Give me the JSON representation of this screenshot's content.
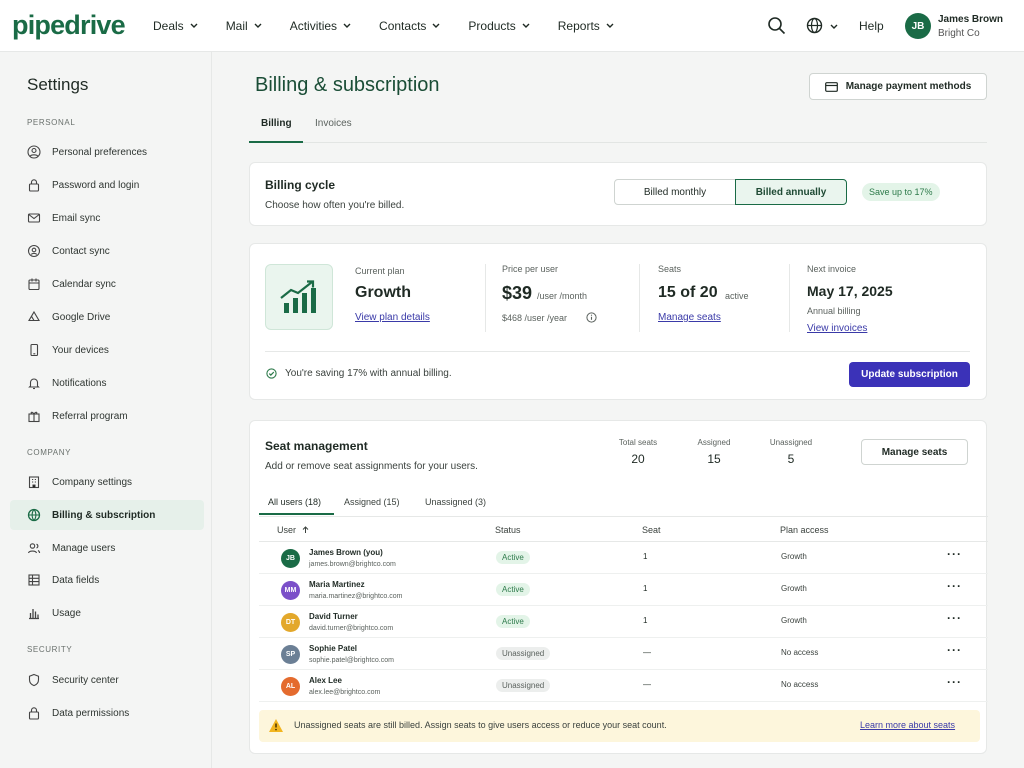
{
  "brand": {
    "logo": "pipedrive",
    "accent": "#1a6b46",
    "primary_button": "#3b32b8"
  },
  "nav": {
    "items": [
      "Deals",
      "Mail",
      "Activities",
      "Contacts",
      "Products",
      "Reports"
    ],
    "help": "Help",
    "user": {
      "initials": "JB",
      "name": "James Brown",
      "company": "Bright Co"
    }
  },
  "sidebar": {
    "title": "Settings",
    "sections": [
      {
        "label": "PERSONAL",
        "items": [
          {
            "label": "Personal preferences",
            "icon": "user-circle-icon"
          },
          {
            "label": "Password and login",
            "icon": "lock-icon"
          },
          {
            "label": "Email sync",
            "icon": "mail-icon"
          },
          {
            "label": "Contact sync",
            "icon": "contact-sync-icon"
          },
          {
            "label": "Calendar sync",
            "icon": "calendar-icon"
          },
          {
            "label": "Google Drive",
            "icon": "drive-icon"
          },
          {
            "label": "Your devices",
            "icon": "phone-icon"
          },
          {
            "label": "Notifications",
            "icon": "bell-icon"
          },
          {
            "label": "Referral program",
            "icon": "gift-icon"
          }
        ]
      },
      {
        "label": "COMPANY",
        "items": [
          {
            "label": "Company settings",
            "icon": "building-icon"
          },
          {
            "label": "Billing & subscription",
            "icon": "billing-icon",
            "active": true
          },
          {
            "label": "Manage users",
            "icon": "users-icon"
          },
          {
            "label": "Data fields",
            "icon": "data-fields-icon"
          },
          {
            "label": "Usage",
            "icon": "usage-icon"
          }
        ]
      },
      {
        "label": "SECURITY",
        "items": [
          {
            "label": "Security center",
            "icon": "shield-icon"
          },
          {
            "label": "Data permissions",
            "icon": "lock-icon"
          }
        ]
      }
    ]
  },
  "page": {
    "title": "Billing & subscription",
    "manage_payment": "Manage payment methods",
    "tabs": [
      "Billing",
      "Invoices"
    ]
  },
  "billing_cycle": {
    "title": "Billing cycle",
    "subtitle": "Choose how often you're billed.",
    "monthly": "Billed monthly",
    "annually": "Billed annually",
    "save_badge": "Save up to 17%"
  },
  "plan": {
    "current_label": "Current plan",
    "name": "Growth",
    "view_details": "View plan details",
    "price_label": "Price per user",
    "price": "$39",
    "price_unit": "/user  /month",
    "annual_price": "$468  /user  /year",
    "seats_label": "Seats",
    "seats_value": "15 of 20",
    "seats_suffix": "active",
    "manage_seats": "Manage seats",
    "next_invoice_label": "Next invoice",
    "next_invoice_date": "May 17, 2025",
    "annual_billing": "Annual billing",
    "view_invoices": "View invoices",
    "saving_note": "You're saving 17% with annual billing.",
    "update_button": "Update subscription"
  },
  "seats": {
    "title": "Seat management",
    "subtitle": "Add or remove seat assignments for your users.",
    "stats": [
      {
        "label": "Total seats",
        "value": "20"
      },
      {
        "label": "Assigned",
        "value": "15"
      },
      {
        "label": "Unassigned",
        "value": "5"
      }
    ],
    "manage_button": "Manage seats",
    "tabs": [
      "All users (18)",
      "Assigned (15)",
      "Unassigned (3)"
    ],
    "columns": [
      "User",
      "Status",
      "Seat",
      "Plan access"
    ],
    "rows": [
      {
        "initials": "JB",
        "color": "#1a6b46",
        "name": "James Brown (you)",
        "email": "james.brown@brightco.com",
        "status": "Active",
        "seat": "1",
        "plan": "Growth"
      },
      {
        "initials": "MM",
        "color": "#7b4fc9",
        "name": "Maria Martinez",
        "email": "maria.martinez@brightco.com",
        "status": "Active",
        "seat": "1",
        "plan": "Growth"
      },
      {
        "initials": "DT",
        "color": "#e3a82b",
        "name": "David Turner",
        "email": "david.turner@brightco.com",
        "status": "Active",
        "seat": "1",
        "plan": "Growth"
      },
      {
        "initials": "SP",
        "color": "#6b7f95",
        "name": "Sophie Patel",
        "email": "sophie.patel@brightco.com",
        "status": "Unassigned",
        "seat": "—",
        "plan": "No access"
      },
      {
        "initials": "AL",
        "color": "#e46b2e",
        "name": "Alex Lee",
        "email": "alex.lee@brightco.com",
        "status": "Unassigned",
        "seat": "—",
        "plan": "No access"
      }
    ],
    "warning": "Unassigned seats are still billed. Assign seats to give users access or reduce your seat count.",
    "learn_more": "Learn more about seats"
  }
}
